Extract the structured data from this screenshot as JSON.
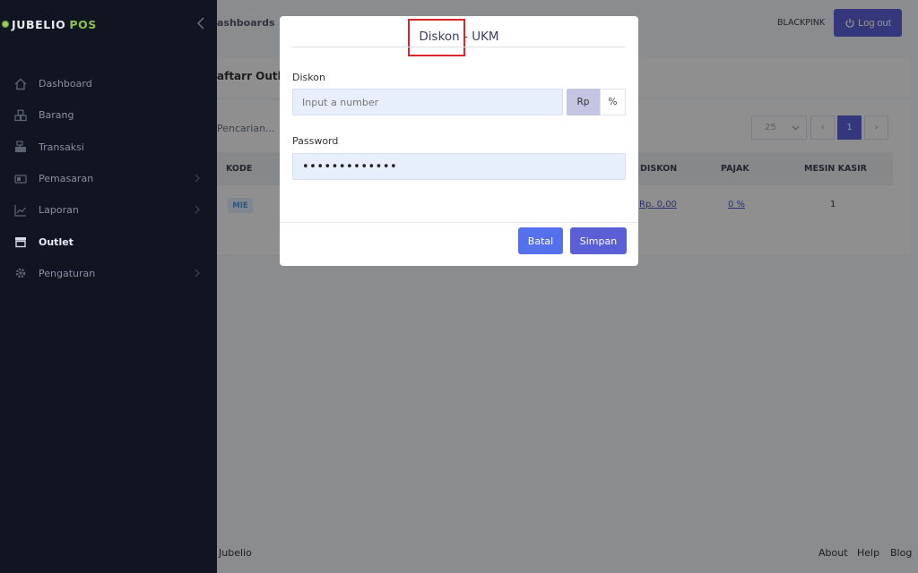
{
  "sidebar": {
    "brand_name": "JUBELIO",
    "brand_suffix": "POS",
    "items": [
      {
        "label": "Dashboard",
        "icon": "home-icon"
      },
      {
        "label": "Barang",
        "icon": "cubes-icon"
      },
      {
        "label": "Transaksi",
        "icon": "cash-register-icon"
      },
      {
        "label": "Pemasaran",
        "icon": "megaphone-icon"
      },
      {
        "label": "Laporan",
        "icon": "chart-line-icon"
      },
      {
        "label": "Outlet",
        "icon": "store-icon"
      },
      {
        "label": "Pengaturan",
        "icon": "gear-icon"
      }
    ]
  },
  "header": {
    "breadcrumb": "ashboards",
    "user": "BLACKPINK",
    "logout_label": "Log out"
  },
  "page": {
    "title": "aftarr Outle",
    "search_placeholder": "Pencarian...",
    "page_size": "25",
    "prev": "‹",
    "current_page": "1",
    "next": "›",
    "columns": {
      "kode": "KODE",
      "diskon": "DISKON",
      "pajak": "PAJAK",
      "mesin_kasir": "MESIN KASIR"
    },
    "row": {
      "kode": "MIE",
      "diskon": "Rp. 0,00",
      "pajak": "0 %",
      "mesin_kasir": "1"
    }
  },
  "footer": {
    "copyright": "Jubelio",
    "links": [
      "About",
      "Help",
      "Blog"
    ]
  },
  "modal": {
    "title": "Diskon - UKM",
    "diskon_label": "Diskon",
    "diskon_placeholder": "Input a number",
    "unit_rp": "Rp",
    "unit_pct": "%",
    "password_label": "Password",
    "password_value": "•••••••••••••",
    "cancel_label": "Batal",
    "save_label": "Simpan"
  },
  "colors": {
    "sidebar_bg": "#111421",
    "primary": "#5b5fd6",
    "accent_green": "#8bc34a",
    "highlight": "#d9262d"
  }
}
